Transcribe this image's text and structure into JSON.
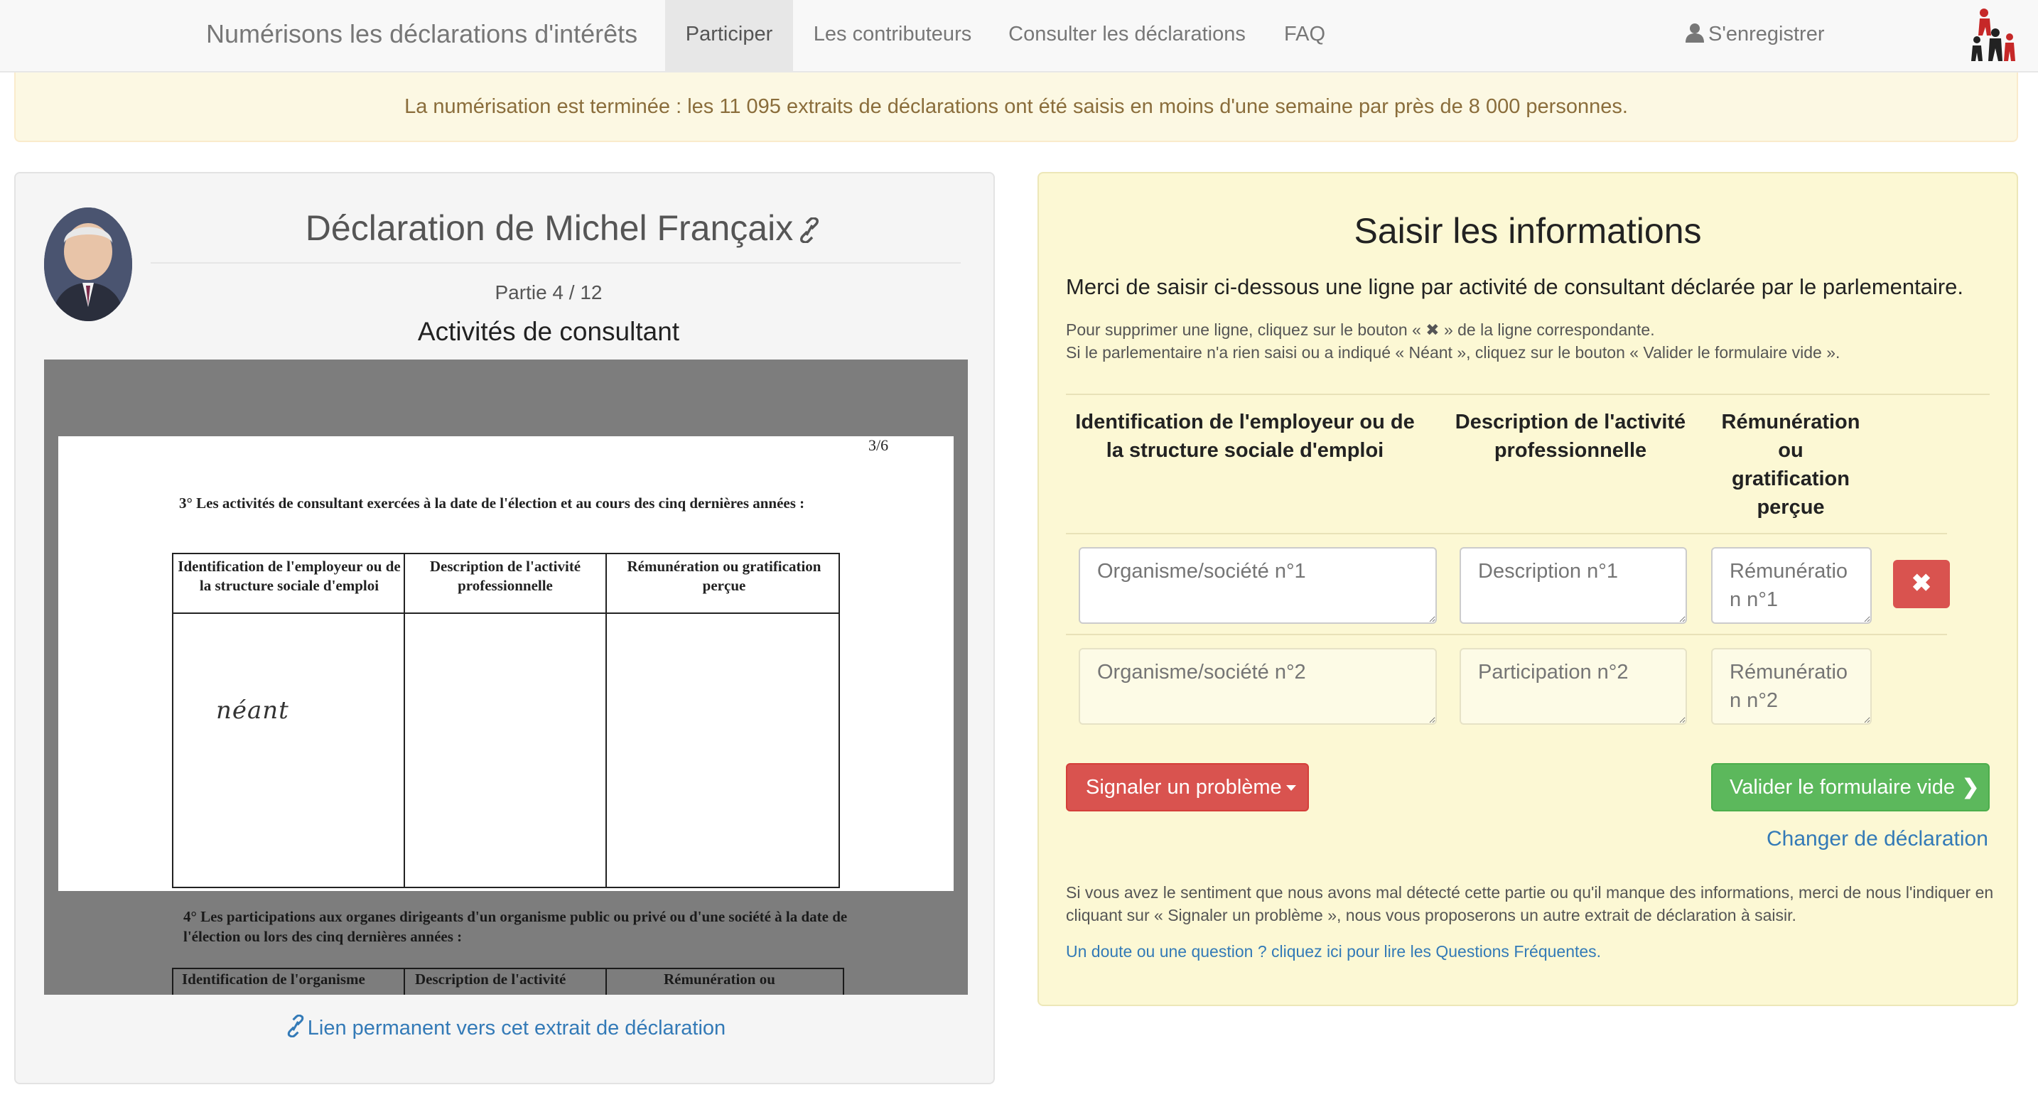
{
  "navbar": {
    "brand": "Numérisons les déclarations d'intérêts",
    "items": [
      {
        "label": "Participer",
        "active": true
      },
      {
        "label": "Les contributeurs",
        "active": false
      },
      {
        "label": "Consulter les déclarations",
        "active": false
      },
      {
        "label": "FAQ",
        "active": false
      }
    ],
    "register": "S'enregistrer"
  },
  "alert": {
    "text": "La numérisation est terminée : les 11 095 extraits de déclarations ont été saisis en moins d'une semaine par près de 8 000 personnes."
  },
  "declaration": {
    "title": "Déclaration de Michel Françaix",
    "part": "Partie 4 / 12",
    "section": "Activités de consultant",
    "permalink": "Lien permanent vers cet extrait de déclaration",
    "scan": {
      "page_number": "3/6",
      "question3": "3° Les activités de consultant exercées à la date de l'élection et au cours des cinq dernières années :",
      "headers": [
        "Identification de l'employeur ou de la structure sociale d'emploi",
        "Description de l'activité professionnelle",
        "Rémunération ou gratification perçue"
      ],
      "handwritten": "néant",
      "question4": "4° Les participations aux organes dirigeants d'un organisme public ou privé ou d'une société à la date de l'élection ou lors des cinq dernières années :",
      "headers2": [
        "Identification de l'organisme",
        "Description de l'activité",
        "Rémunération ou"
      ]
    }
  },
  "form": {
    "title": "Saisir les informations",
    "intro": "Merci de saisir ci-dessous une ligne par activité de consultant déclarée par le parlementaire.",
    "hint1": "Pour supprimer une ligne, cliquez sur le bouton « ✖ » de la ligne correspondante.",
    "hint2": "Si le parlementaire n'a rien saisi ou a indiqué « Néant », cliquez sur le bouton « Valider le formulaire vide ».",
    "columns": [
      "Identification de l'employeur ou de la structure sociale d'emploi",
      "Description de l'activité professionnelle",
      "Rémunération ou gratification perçue"
    ],
    "rows": [
      {
        "org": "Organisme/société n°1",
        "desc": "Description n°1",
        "rem": "Rémunération n°1"
      },
      {
        "org": "Organisme/société n°2",
        "desc": "Participation n°2",
        "rem": "Rémunération n°2"
      }
    ],
    "delete_icon": "✖",
    "report_button": "Signaler un problème",
    "validate_button": "Valider le formulaire vide",
    "change_link": "Changer de déclaration",
    "footer": "Si vous avez le sentiment que nous avons mal détecté cette partie ou qu'il manque des informations, merci de nous l'indiquer en cliquant sur « Signaler un problème », nous vous proposerons un autre extrait de déclaration à saisir.",
    "faq_link": "Un doute ou une question ? cliquez ici pour lire les Questions Fréquentes."
  },
  "colors": {
    "navbar_bg": "#f8f8f8",
    "alert_bg": "#fcf8e3",
    "alert_text": "#8a6d3b",
    "form_bg": "#fcf8d4",
    "danger": "#d9534f",
    "success": "#5cb85c",
    "link": "#337ab7"
  }
}
